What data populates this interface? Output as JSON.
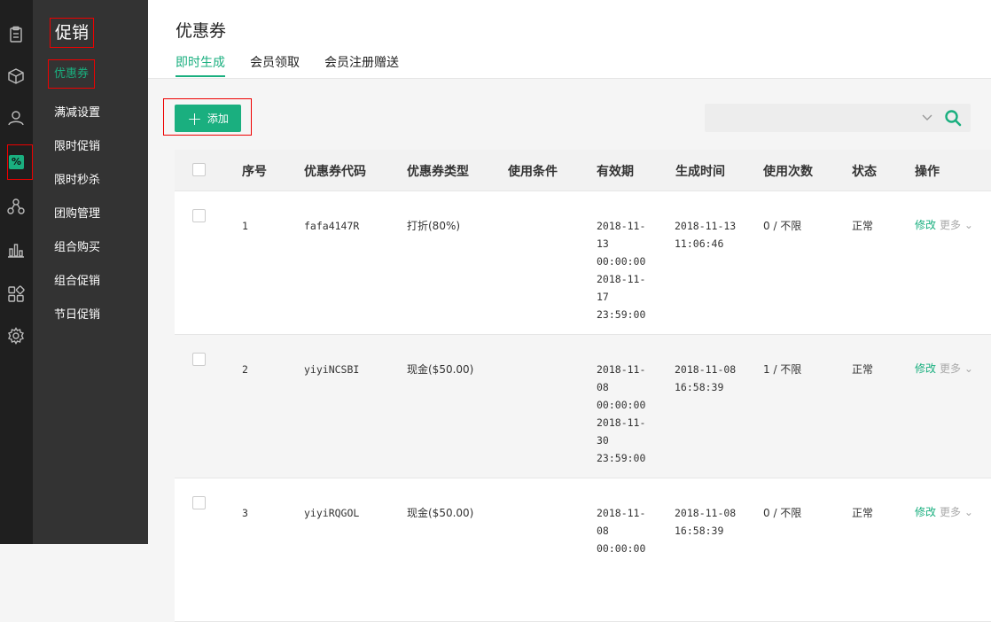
{
  "rail": {
    "icons": [
      "clipboard-icon",
      "box-icon",
      "user-icon",
      "discount-icon",
      "network-icon",
      "bar-chart-icon",
      "apps-icon",
      "gear-icon"
    ],
    "active_badge": "%"
  },
  "subnav": {
    "title": "促销",
    "items": [
      "优惠券",
      "满减设置",
      "限时促销",
      "限时秒杀",
      "团购管理",
      "组合购买",
      "组合促销",
      "节日促销"
    ]
  },
  "header": {
    "title": "优惠券",
    "tabs": [
      "即时生成",
      "会员领取",
      "会员注册赠送"
    ]
  },
  "toolbar": {
    "add_label": "添加",
    "search_value": ""
  },
  "table": {
    "columns": [
      "序号",
      "优惠券代码",
      "优惠券类型",
      "使用条件",
      "有效期",
      "生成时间",
      "使用次数",
      "状态",
      "操作"
    ],
    "rows": [
      {
        "index": "1",
        "code": "fafa4147R",
        "type": "打折(80%)",
        "condition": "",
        "validity": [
          "2018-11-",
          "13",
          "00:00:00",
          "2018-11-",
          "17",
          "23:59:00"
        ],
        "created": [
          "2018-11-13",
          "11:06:46"
        ],
        "usage": "0 / 不限",
        "status": "正常",
        "edit": "修改",
        "more": "更多"
      },
      {
        "index": "2",
        "code": "yiyiNCSBI",
        "type": "现金($50.00)",
        "condition": "",
        "validity": [
          "2018-11-",
          "08",
          "00:00:00",
          "2018-11-",
          "30",
          "23:59:00"
        ],
        "created": [
          "2018-11-08",
          "16:58:39"
        ],
        "usage": "1 / 不限",
        "status": "正常",
        "edit": "修改",
        "more": "更多"
      },
      {
        "index": "3",
        "code": "yiyiRQGOL",
        "type": "现金($50.00)",
        "condition": "",
        "validity": [
          "2018-11-",
          "08",
          "00:00:00"
        ],
        "created": [
          "2018-11-08",
          "16:58:39"
        ],
        "usage": "0 / 不限",
        "status": "正常",
        "edit": "修改",
        "more": "更多"
      }
    ]
  },
  "colors": {
    "accent": "#1aaf7f",
    "rail_bg": "#1f1f1f",
    "subnav_bg": "#333333",
    "highlight_border": "#ee0000"
  }
}
